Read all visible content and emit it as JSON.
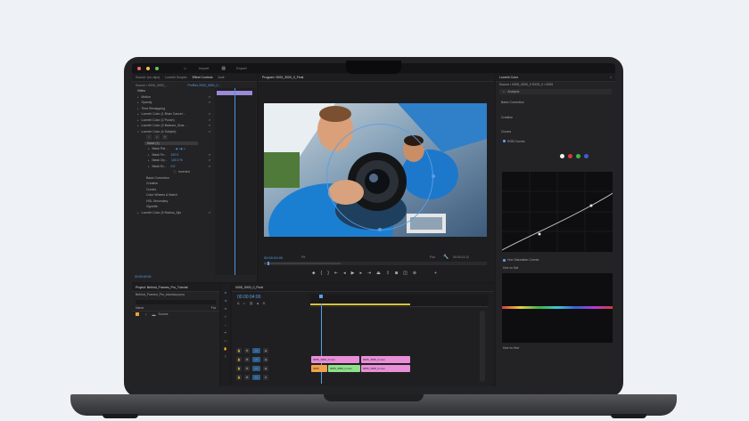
{
  "menubar": {
    "tabs": [
      "Import",
      "Export"
    ]
  },
  "left_panel": {
    "tabs": [
      "Source: (no clips)",
      "Lumetri Scopes",
      "Effect Controls",
      "Audi"
    ],
    "source_label": "Source • 0005_3000_…",
    "clip_label": "ProRes 2000_3000_0…",
    "section": "Video",
    "rows": [
      "Motion",
      "Opacity",
      "Time Remapping",
      "Lumetri Color (1 Bluer Cancel…",
      "Lumetri Color (2 Punch)",
      "Lumetri Color (3 Balance_Shar…",
      "Lumetri Color (4 Subject)"
    ],
    "mask_label": "Mask (1)",
    "mask_rows": [
      "Mask Pat…",
      "Mask Fe…",
      "Mask Op…",
      "Mask Ex…"
    ],
    "mask_values": [
      "",
      "100.0",
      "100.0 %",
      "0.0"
    ],
    "inverted": "Inverted",
    "rows2": [
      "Basic Correction",
      "Creative",
      "Curves",
      "Color Wheels & Match",
      "HSL Secondary",
      "Vignette",
      "Lumetri Color (5 Radius_Ajio"
    ],
    "timecode": "00:00:00:00"
  },
  "program": {
    "title": "Program: 0005_3000_0_Final",
    "timecode_left": "00:00:04:00",
    "fit": "Fit",
    "quality": "Full",
    "timecode_right": "00:00:11:11"
  },
  "project": {
    "tab": "Project: Behind_Frames_Pro_Tutorial",
    "file": "Behind_Frames_Pro_tutorial.prproj",
    "col_name": "Name",
    "col_fps": "Fra",
    "bin": "Source"
  },
  "timeline": {
    "tab": "0005_3000_0_Final",
    "timecode": "00:00:04:00",
    "tracks": [
      "V3",
      "V2",
      "V1",
      "A1",
      "A2"
    ],
    "clips": {
      "v2a": "0005_3000_0.mov",
      "v2b": "0005_3000_0.mov",
      "v1a": "0005",
      "v1b": "0005_3000_0.mov",
      "v1c": "0005_3000_0.mov"
    }
  },
  "lumetri": {
    "tab": "Lumetri Color",
    "source": "Source • 0005_3000_0 SX23_0 • 0005",
    "preset": "Analysis",
    "sections": [
      "Basic Correction",
      "Creative",
      "Curves"
    ],
    "rgb_curves": "RGB Curves",
    "hue_sat": "Hue Saturation Curves",
    "hue_vs_sat": "Hue vs Sat",
    "hue_vs_hue": "Hue vs Hue",
    "colors": {
      "white": "#f2f2f2",
      "red": "#d43b3b",
      "green": "#3fb24a",
      "blue": "#3b5fd4"
    }
  }
}
